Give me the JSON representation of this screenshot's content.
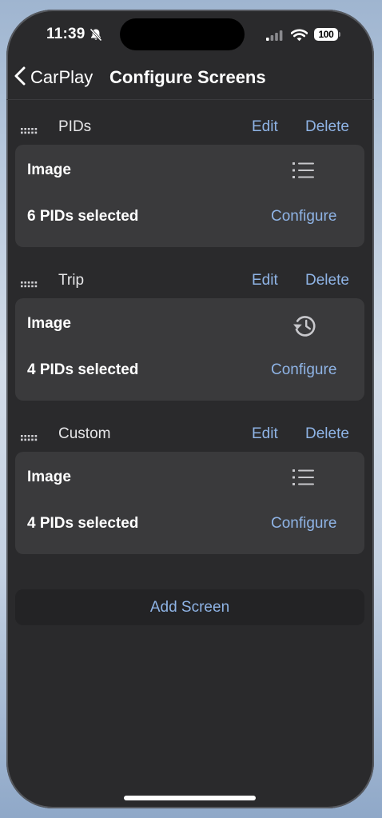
{
  "status_bar": {
    "time": "11:39",
    "battery": "100"
  },
  "nav": {
    "back_label": "CarPlay",
    "title": "Configure Screens"
  },
  "sections": [
    {
      "title": "PIDs",
      "edit_label": "Edit",
      "delete_label": "Delete",
      "image_label": "Image",
      "icon": "list-icon",
      "pids_text": "6 PIDs selected",
      "configure_label": "Configure"
    },
    {
      "title": "Trip",
      "edit_label": "Edit",
      "delete_label": "Delete",
      "image_label": "Image",
      "icon": "history-icon",
      "pids_text": "4 PIDs selected",
      "configure_label": "Configure"
    },
    {
      "title": "Custom",
      "edit_label": "Edit",
      "delete_label": "Delete",
      "image_label": "Image",
      "icon": "list-icon",
      "pids_text": "4 PIDs selected",
      "configure_label": "Configure"
    }
  ],
  "add_screen_label": "Add Screen",
  "colors": {
    "accent": "#8fb4e6",
    "background": "#2a2a2c",
    "card": "#3a3a3c"
  }
}
